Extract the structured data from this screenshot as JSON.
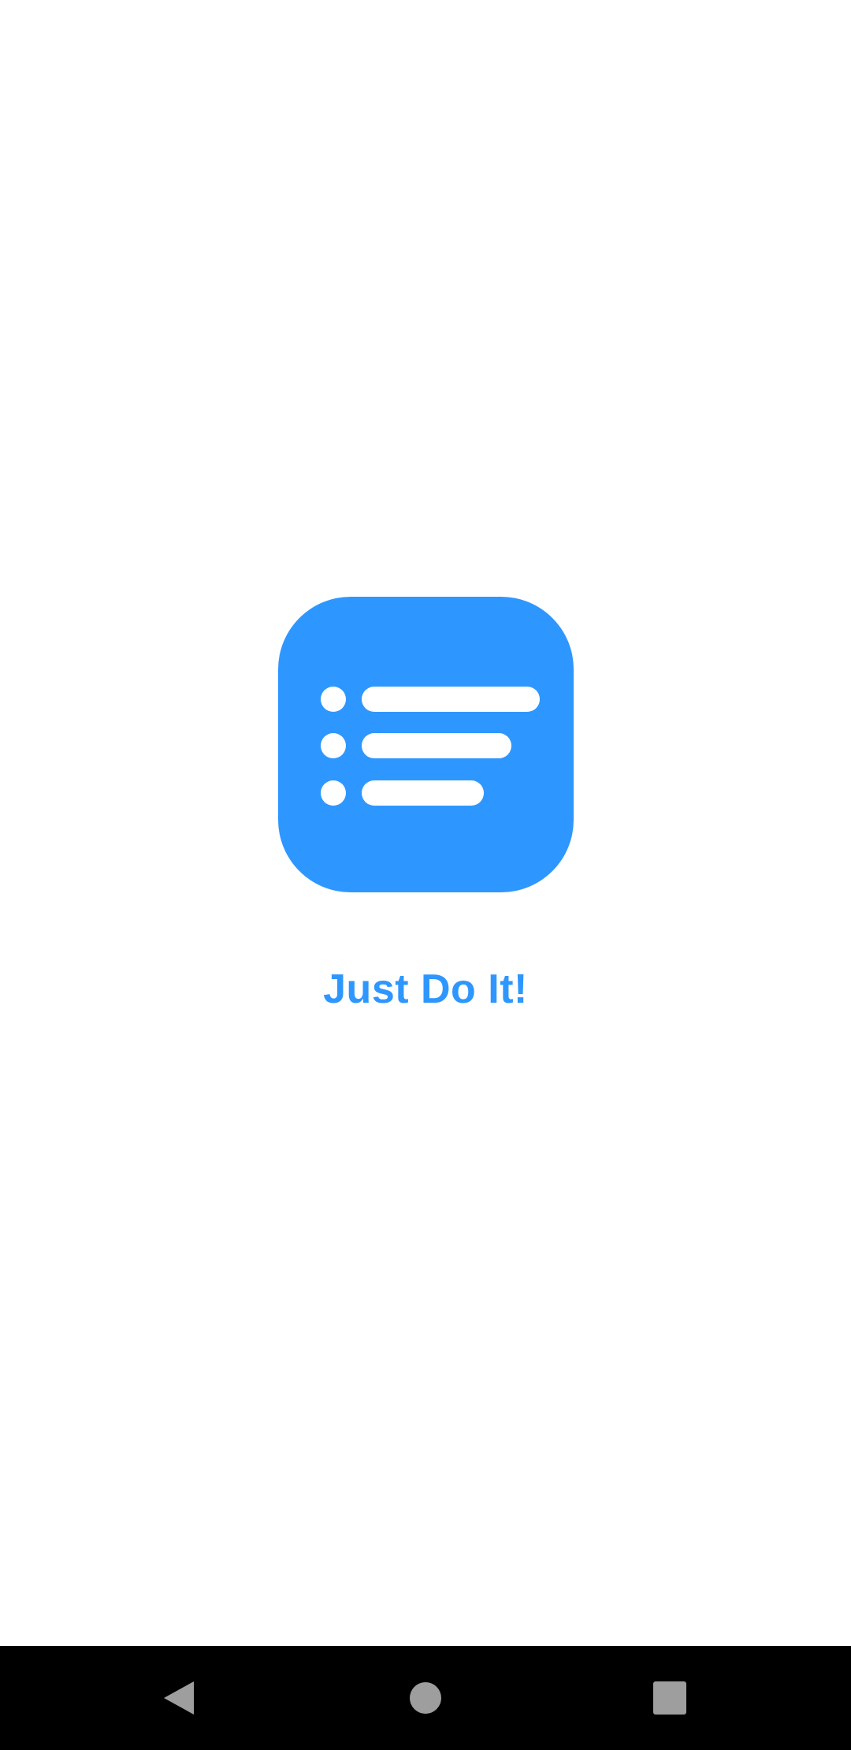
{
  "app": {
    "title": "Just Do It!",
    "logo_icon": "task-list-icon",
    "accent_color": "#2E97FF",
    "background_color": "#FFFFFF"
  },
  "navigation_bar": {
    "background_color": "#000000",
    "button_color": "#9E9E9E",
    "buttons": [
      {
        "icon": "back-triangle-icon"
      },
      {
        "icon": "home-circle-icon"
      },
      {
        "icon": "recents-square-icon"
      }
    ]
  }
}
